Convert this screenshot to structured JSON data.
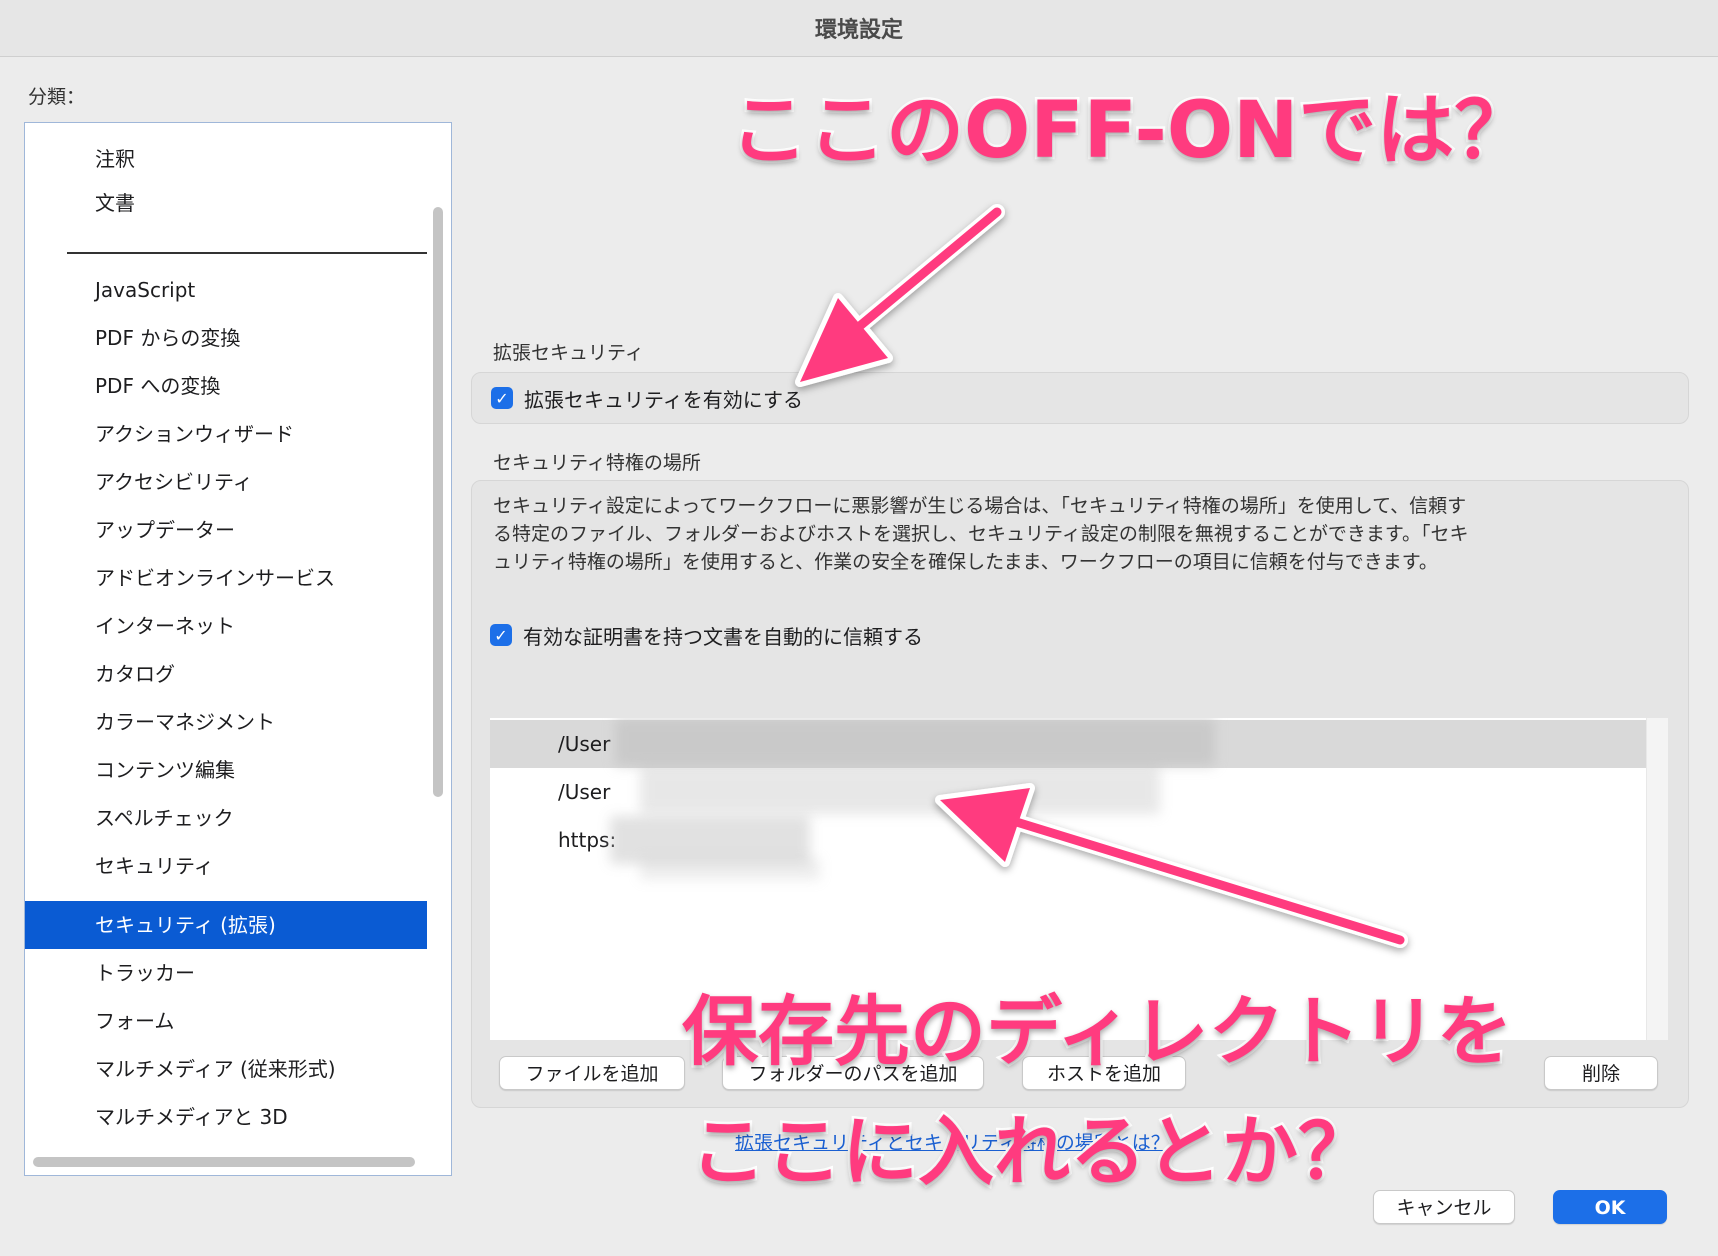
{
  "window": {
    "title": "環境設定"
  },
  "sidebar": {
    "label": "分類：",
    "items_top": [
      "注釈",
      "文書"
    ],
    "items": [
      "JavaScript",
      "PDF からの変換",
      "PDF への変換",
      "アクションウィザード",
      "アクセシビリティ",
      "アップデーター",
      "アドビオンラインサービス",
      "インターネット",
      "カタログ",
      "カラーマネジメント",
      "コンテンツ編集",
      "スペルチェック",
      "セキュリティ",
      "セキュリティ (拡張)",
      "トラッカー",
      "フォーム",
      "マルチメディア (従来形式)",
      "マルチメディアと 3D"
    ],
    "selected": "セキュリティ (拡張)"
  },
  "enhanced_security": {
    "label": "拡張セキュリティ",
    "checkbox_label": "拡張セキュリティを有効にする",
    "checked": true
  },
  "privileged_locations": {
    "label": "セキュリティ特権の場所",
    "description": "セキュリティ設定によってワークフローに悪影響が生じる場合は、「セキュリティ特権の場所」を使用して、信頼する特定のファイル、フォルダーおよびホストを選択し、セキュリティ設定の制限を無視することができます。「セキュリティ特権の場所」を使用すると、作業の安全を確保したまま、ワークフローの項目に信頼を付与できます。",
    "trust_cert_label": "有効な証明書を持つ文書を自動的に信頼する",
    "trust_cert_checked": true,
    "entries": [
      "/User",
      "/User",
      "https:"
    ],
    "buttons": {
      "add_file": "ファイルを追加",
      "add_folder": "フォルダーのパスを追加",
      "add_host": "ホストを追加",
      "remove": "削除"
    }
  },
  "link_text": "拡張セキュリティとセキュリティ特権の場所とは？",
  "footer": {
    "cancel": "キャンセル",
    "ok": "OK"
  },
  "annotations": {
    "top": "ここのOFF-ONでは？",
    "bottom_line1": "保存先のディレクトリを",
    "bottom_line2": "ここに入れるとか？",
    "color": "#ff3b7f"
  }
}
